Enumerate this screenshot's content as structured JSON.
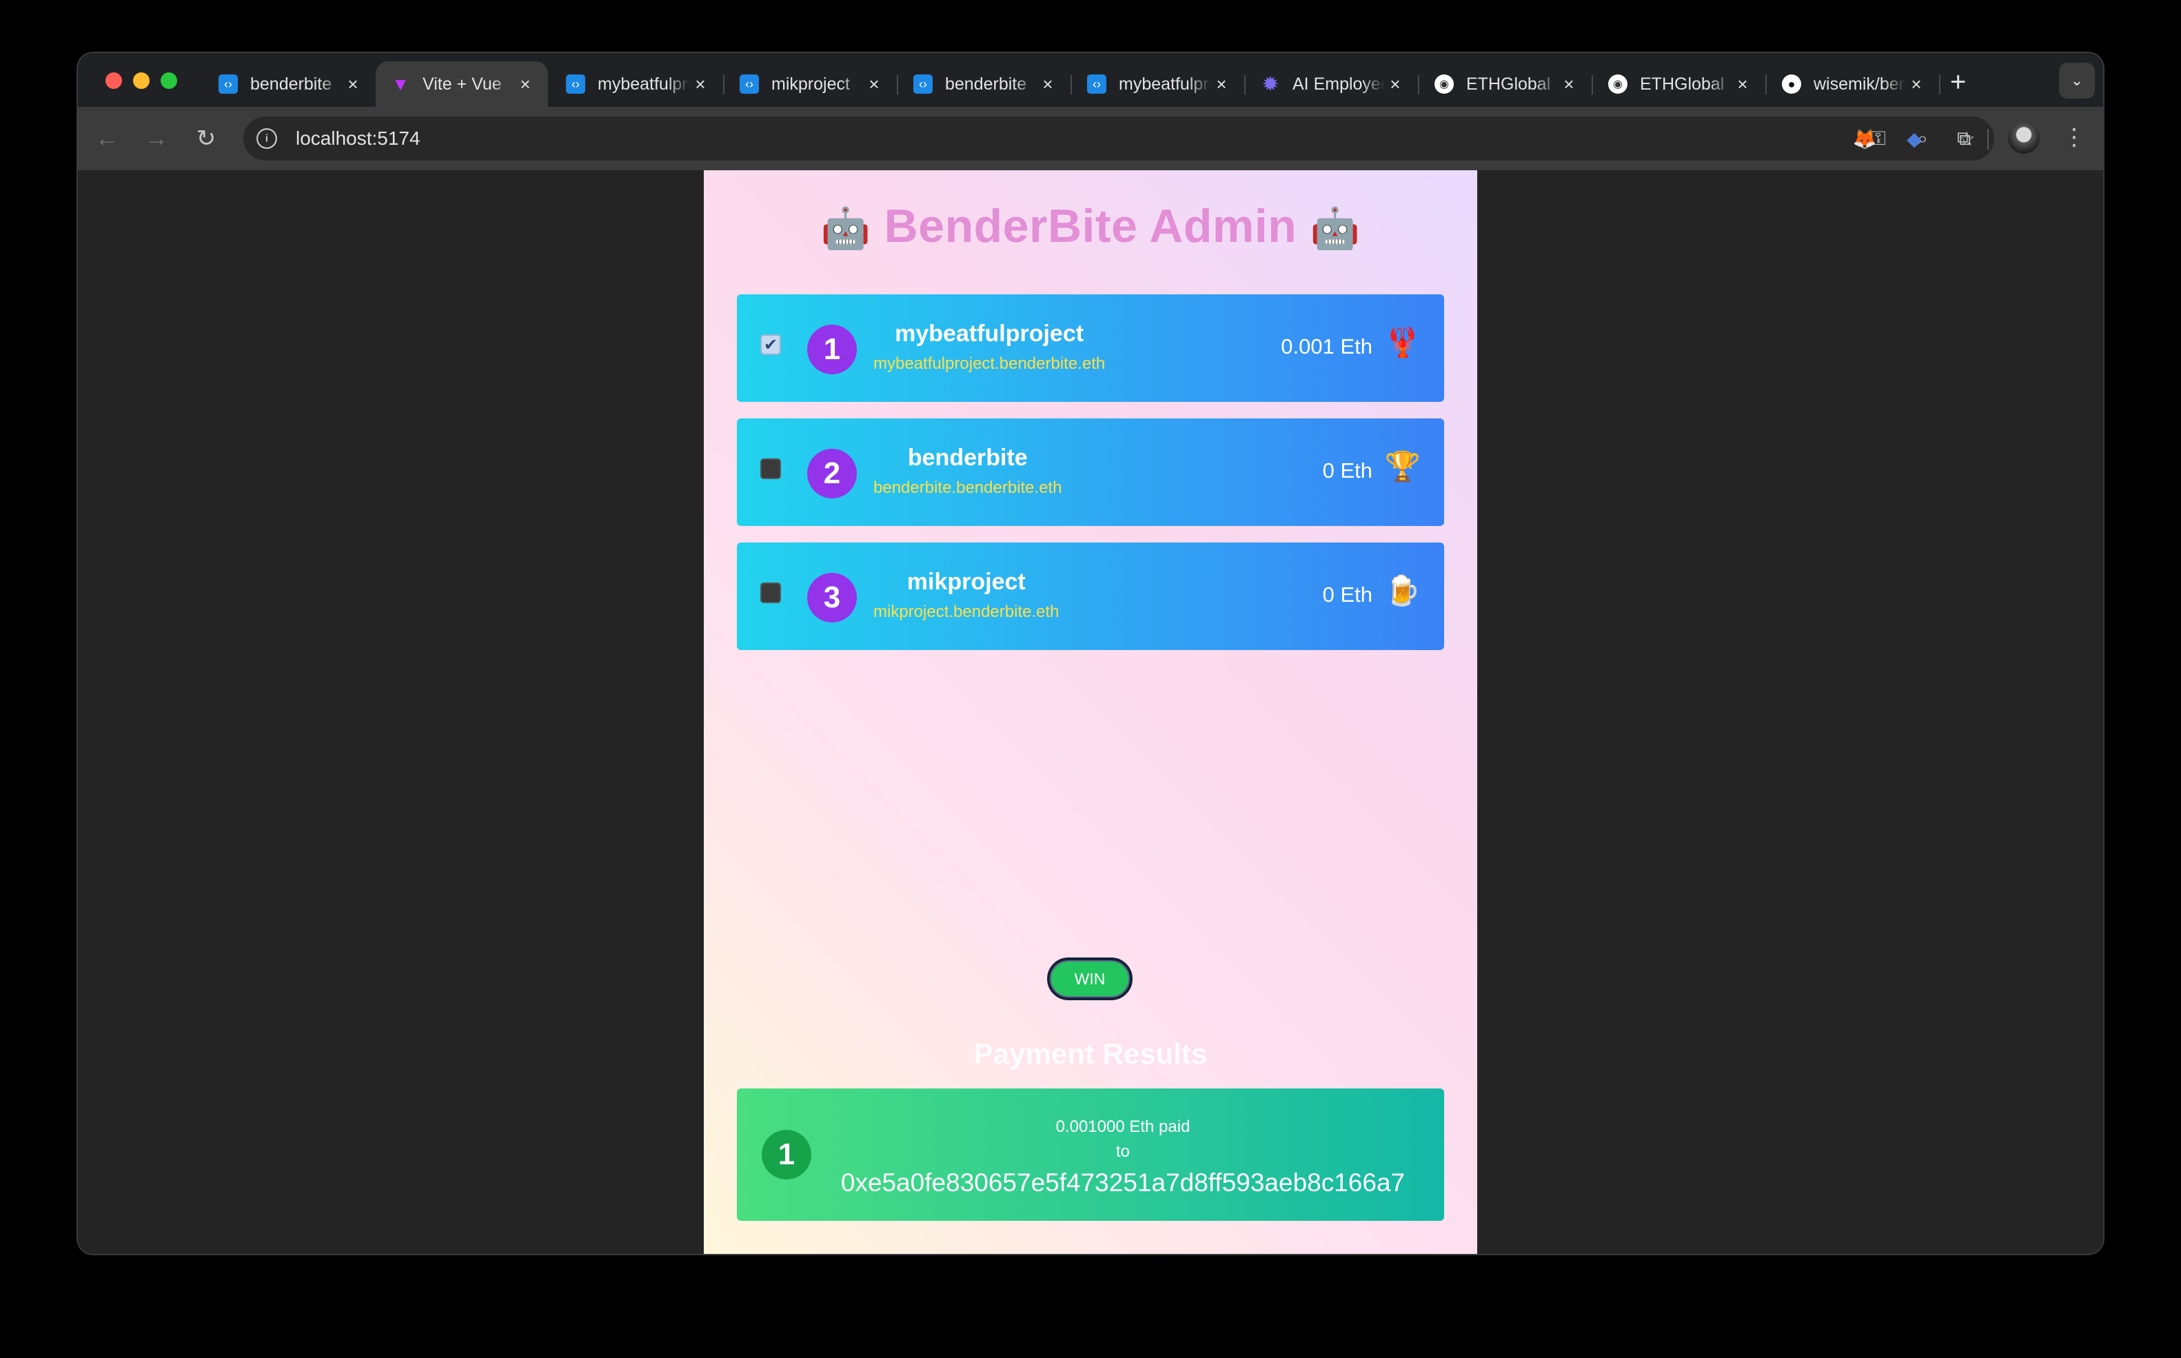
{
  "browser": {
    "tabs": [
      {
        "label": "benderbite",
        "favicon": "vscode-icon",
        "color": "#1e88e5",
        "active": false
      },
      {
        "label": "Vite + Vue",
        "favicon": "vite-icon",
        "color": "#bd34fe",
        "active": true
      },
      {
        "label": "mybeatfulproject",
        "favicon": "vscode-icon",
        "color": "#1e88e5",
        "active": false
      },
      {
        "label": "mikproject",
        "favicon": "vscode-icon",
        "color": "#1e88e5",
        "active": false
      },
      {
        "label": "benderbite",
        "favicon": "vscode-icon",
        "color": "#1e88e5",
        "active": false
      },
      {
        "label": "mybeatfulproject",
        "favicon": "vscode-icon",
        "color": "#1e88e5",
        "active": false
      },
      {
        "label": "AI Employee",
        "favicon": "gear-icon",
        "color": "#6d5bd0",
        "active": false
      },
      {
        "label": "ETHGlobal",
        "favicon": "ethglobal-icon",
        "color": "#ffffff",
        "active": false
      },
      {
        "label": "ETHGlobal",
        "favicon": "ethglobal-icon",
        "color": "#ffffff",
        "active": false
      },
      {
        "label": "wisemik/benderbite",
        "favicon": "github-icon",
        "color": "#ffffff",
        "active": false
      }
    ],
    "url": "localhost:5174"
  },
  "app": {
    "title": "BenderBite Admin",
    "title_icon": "robot-icon",
    "projects": [
      {
        "rank": "1",
        "name": "mybeatfulproject",
        "ens": "mybeatfulproject.benderbite.eth",
        "amount": "0.001 Eth",
        "emoji": "🦞",
        "checked": true,
        "check_mark": "✔"
      },
      {
        "rank": "2",
        "name": "benderbite",
        "ens": "benderbite.benderbite.eth",
        "amount": "0 Eth",
        "emoji": "🏆",
        "checked": false,
        "check_mark": ""
      },
      {
        "rank": "3",
        "name": "mikproject",
        "ens": "mikproject.benderbite.eth",
        "amount": "0 Eth",
        "emoji": "🍺",
        "checked": false,
        "check_mark": ""
      }
    ],
    "win_button": "WIN",
    "results_title": "Payment Results",
    "results": [
      {
        "rank": "1",
        "paid_line": "0.001000 Eth paid",
        "to_line": "to",
        "address": "0xe5a0fe830657e5f473251a7d8ff593aeb8c166a7"
      }
    ]
  }
}
